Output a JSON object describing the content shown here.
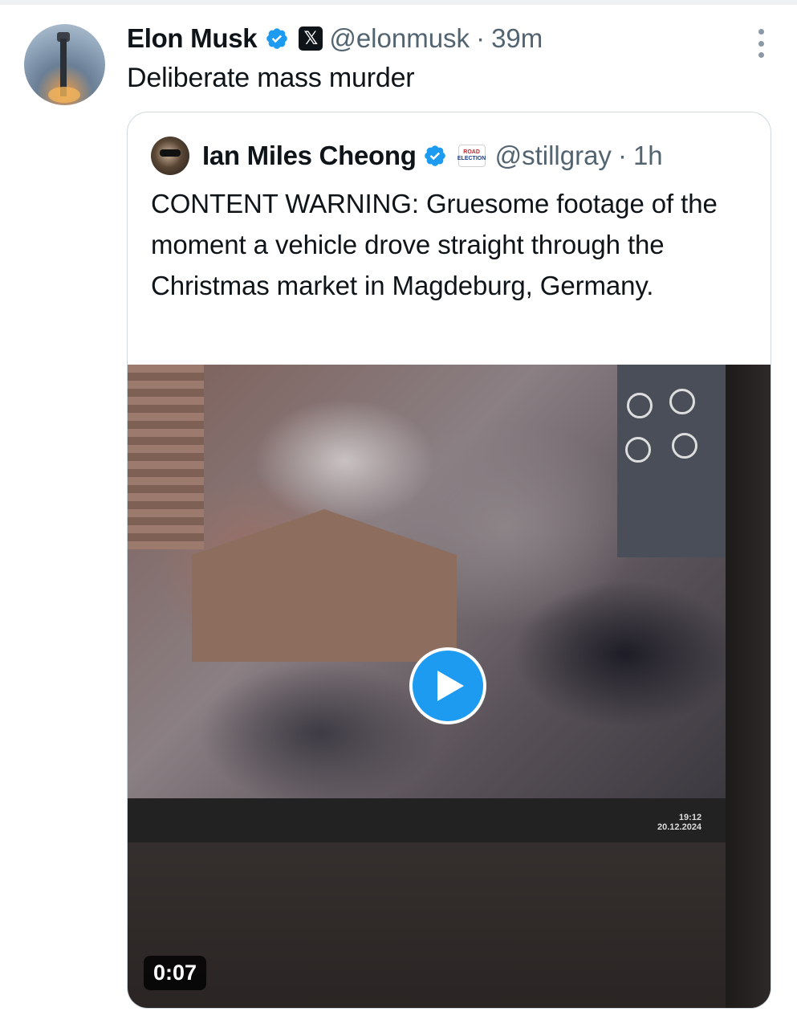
{
  "tweet": {
    "author_name": "Elon Musk",
    "handle": "@elonmusk",
    "separator": "·",
    "time": "39m",
    "text": "Deliberate mass murder",
    "badge_color": "#1d9bf0",
    "affiliate_icon": "x-logo-icon",
    "affiliate_label": "𝕏"
  },
  "quote": {
    "author_name": "Ian Miles Cheong",
    "handle": "@stillgray",
    "separator": "·",
    "time": "1h",
    "text": "CONTENT WARNING: Gruesome footage of the moment a vehicle drove straight through the Christmas market in Magdeburg, Germany.",
    "affiliate_icon": "road-election-icon",
    "affiliate_label_top": "ROAD",
    "affiliate_label_bottom": "ELECTION"
  },
  "video": {
    "duration": "0:07",
    "play_icon": "play-icon",
    "accent_color": "#1d9bf0",
    "overlay_time": "19:12",
    "overlay_date": "20.12.2024"
  }
}
